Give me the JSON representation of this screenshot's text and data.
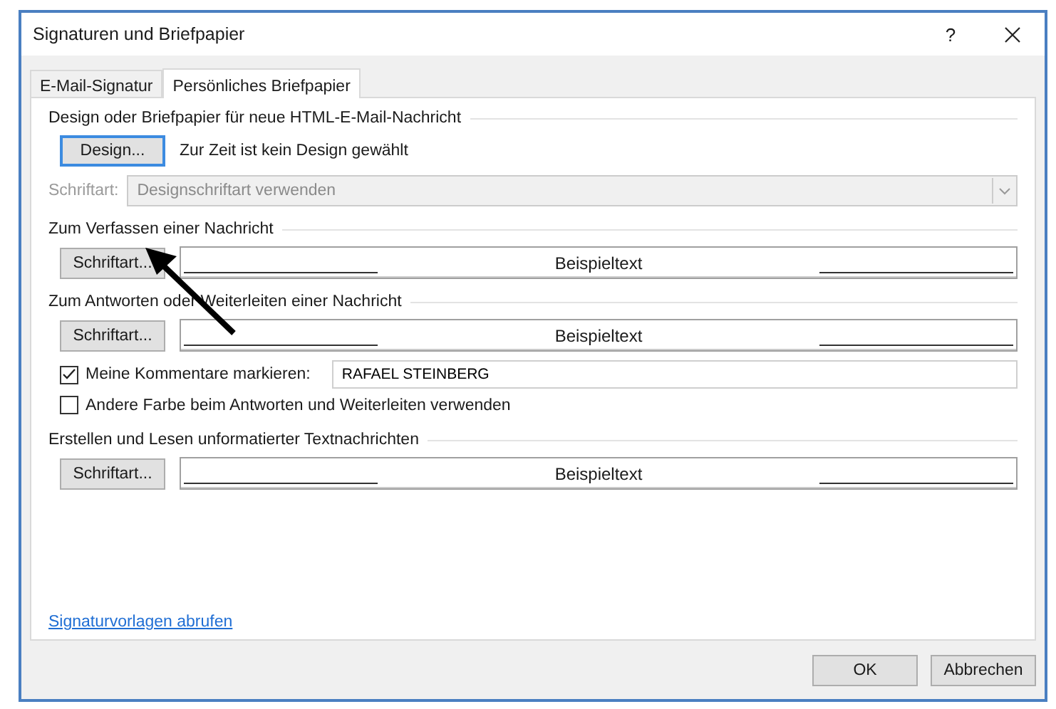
{
  "window": {
    "title": "Signaturen und Briefpapier",
    "help": "?"
  },
  "tabs": [
    {
      "label": "E-Mail-Signatur",
      "selected": false
    },
    {
      "label": "Persönliches Briefpapier",
      "selected": true
    }
  ],
  "sections": [
    {
      "heading": "Design oder Briefpapier für neue HTML-E-Mail-Nachricht",
      "items": [
        {
          "kind": "design_row",
          "button": "Design...",
          "focused": true,
          "status": "Zur Zeit ist kein Design gewählt"
        },
        {
          "kind": "font_select",
          "label": "Schriftart:",
          "value": "Designschriftart verwenden",
          "disabled": true
        }
      ]
    },
    {
      "heading": "Zum Verfassen einer Nachricht",
      "items": [
        {
          "kind": "font_row",
          "button": "Schriftart...",
          "preview": "Beispieltext"
        }
      ]
    },
    {
      "heading": "Zum Antworten oder Weiterleiten einer Nachricht",
      "items": [
        {
          "kind": "font_row",
          "button": "Schriftart...",
          "preview": "Beispieltext"
        },
        {
          "kind": "checkbox_field",
          "label": "Meine Kommentare markieren:",
          "checked": true,
          "value": "RAFAEL STEINBERG"
        },
        {
          "kind": "checkbox",
          "label": "Andere Farbe beim Antworten und Weiterleiten verwenden",
          "checked": false
        }
      ]
    },
    {
      "heading": "Erstellen und Lesen unformatierter Textnachrichten",
      "items": [
        {
          "kind": "font_row",
          "button": "Schriftart...",
          "preview": "Beispieltext"
        }
      ]
    }
  ],
  "link": "Signaturvorlagen abrufen",
  "buttons": [
    "OK",
    "Abbrechen"
  ]
}
